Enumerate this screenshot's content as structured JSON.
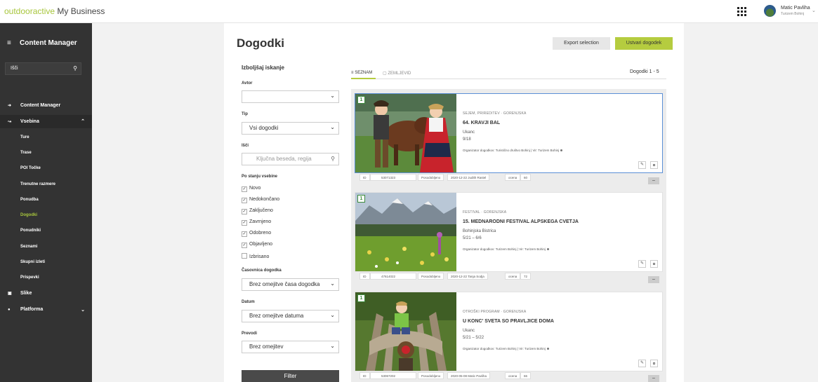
{
  "topbar": {
    "brand": "outdooractive",
    "product": "My Business",
    "user_name": "Matic Pavliha",
    "user_org": "Turizem Bohinj"
  },
  "sidebar": {
    "header": "Content Manager",
    "search_value": "Išči",
    "items": [
      {
        "label": "Content Manager"
      },
      {
        "label": "Vsebina"
      },
      {
        "label": "Slike"
      },
      {
        "label": "Platforma"
      }
    ],
    "subitems": [
      "Ture",
      "Trase",
      "POI Točke",
      "Trenutne razmere",
      "Ponudba",
      "Dogodki",
      "Ponudniki",
      "Seznami",
      "Skupni izleti",
      "Prispevki"
    ],
    "current_subitem": "Dogodki"
  },
  "main": {
    "title": "Dogodki",
    "export_label": "Export selection",
    "create_label": "Ustvari dogodek"
  },
  "filters": {
    "title": "Izboljšaj iskanje",
    "author_label": "Avtor",
    "author_value": "",
    "type_label": "Tip",
    "type_value": "Vsi dogodki",
    "search_label": "Išči",
    "search_placeholder": "Ključna beseda, regija",
    "status_label": "Po stanju vsebine",
    "statuses": [
      {
        "label": "Novo",
        "checked": true
      },
      {
        "label": "Nedokončano",
        "checked": true
      },
      {
        "label": "Zaključeno",
        "checked": true
      },
      {
        "label": "Zavrnjeno",
        "checked": true
      },
      {
        "label": "Odobreno",
        "checked": true
      },
      {
        "label": "Objavljeno",
        "checked": true
      },
      {
        "label": "Izbrisano",
        "checked": false
      }
    ],
    "timeline_label": "Časovnica dogodka",
    "timeline_value": "Brez omejitve časa dogodka",
    "date_label": "Datum",
    "date_value": "Brez omejitve datuma",
    "translations_label": "Prevodi",
    "translations_value": "Brez omejitev",
    "filter_button": "Filter"
  },
  "list": {
    "tab_list": "SEZNAM",
    "tab_map": "ZEMLJEVID",
    "count": "Dogodki 1 - 5",
    "badge": "1",
    "meta_labels": {
      "id": "ID",
      "updated": "Posodobljeno",
      "rating": "ocena"
    },
    "cards": [
      {
        "category": "SEJEM, PRIREDITEV · GORENJSKA",
        "title": "64. KRAVJI BAL",
        "location": "Ukanc",
        "date": "9/18",
        "organizer": "Organizator dogodkov: Turistično društvo Bohinj | Vir: Turizem Bohinj",
        "id": "53071323",
        "updated": "2020-12-22 Judith Rastel",
        "rating": "60"
      },
      {
        "category": "FESTIVAL · GORENJSKA",
        "title": "15. MEDNARODNI FESTIVAL ALPSKEGA CVETJA",
        "location": "Bohinjska Bistrica",
        "date": "5/21 – 6/6",
        "organizer": "Organizator dogodkov: Turizem Bohinj | Vir: Turizem Bohinj",
        "id": "47614022",
        "updated": "2020-12-22 Tanja Sodja",
        "rating": "72"
      },
      {
        "category": "OTROŠKI PROGRAM · GORENJSKA",
        "title": "U KONC' SVETA SO PRAVLJICE DOMA",
        "location": "Ukanc",
        "date": "5/21 – 5/22",
        "organizer": "Organizator dogodkov: Turizem Bohinj | Vir: Turizem Bohinj",
        "id": "53067202",
        "updated": "2020-05-08 Matic Pavliha",
        "rating": "66"
      }
    ]
  },
  "colors": {
    "brand": "#a8c63d",
    "sidebar": "#333333",
    "primary_button": "#b5cc3f",
    "selected_border": "#5b8fd6"
  }
}
